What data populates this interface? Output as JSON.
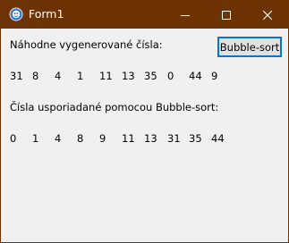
{
  "window": {
    "title": "Form1",
    "titlebar_color": "#6e3305",
    "icon": "app-form-icon",
    "controls": [
      "minimize-icon",
      "maximize-icon",
      "close-icon"
    ]
  },
  "labels": {
    "generated": "Náhodne vygenerované čísla:",
    "sorted": "Čísla usporiadané pomocou Bubble-sort:"
  },
  "button": {
    "label": "Bubble-sort",
    "border_color": "#0078d7"
  },
  "generated_numbers": [
    "31",
    "8",
    "4",
    "1",
    "11",
    "13",
    "35",
    "0",
    "44",
    "9"
  ],
  "sorted_numbers": [
    "0",
    "1",
    "4",
    "8",
    "9",
    "11",
    "13",
    "31",
    "35",
    "44"
  ]
}
